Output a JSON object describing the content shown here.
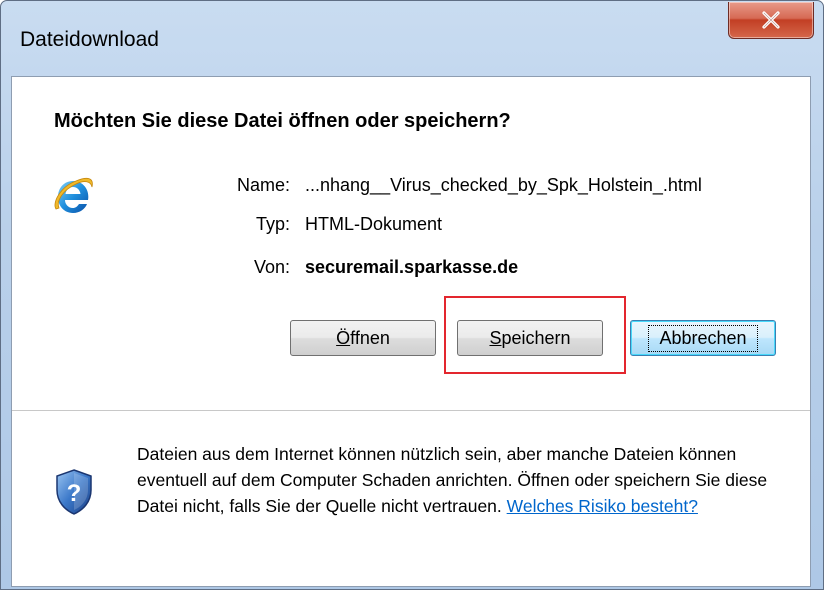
{
  "window": {
    "title": "Dateidownload",
    "close_label": "x"
  },
  "dialog": {
    "question": "Möchten Sie diese Datei öffnen oder speichern?",
    "icon": "internet-explorer-icon",
    "file": {
      "name_label": "Name:",
      "name_value": "...nhang__Virus_checked_by_Spk_Holstein_.html",
      "type_label": "Typ:",
      "type_value": "HTML-Dokument",
      "from_label": "Von:",
      "from_value": "securemail.sparkasse.de"
    },
    "buttons": {
      "open_label": "Öffnen",
      "open_access_key": "Ö",
      "open_rest": "ffnen",
      "save_label": "Speichern",
      "save_access_key": "S",
      "save_rest": "peichern",
      "cancel_label": "Abbrechen"
    },
    "warning": {
      "icon": "security-shield-question-icon",
      "text": "Dateien aus dem Internet können nützlich sein, aber manche Dateien können eventuell auf dem Computer Schaden anrichten. Öffnen oder speichern Sie diese Datei nicht, falls Sie der Quelle nicht vertrauen.",
      "link_text": "Welches Risiko besteht?"
    }
  },
  "colors": {
    "highlight_box": "#e3262e",
    "link": "#0066cc",
    "close_button": "#c23f24"
  }
}
